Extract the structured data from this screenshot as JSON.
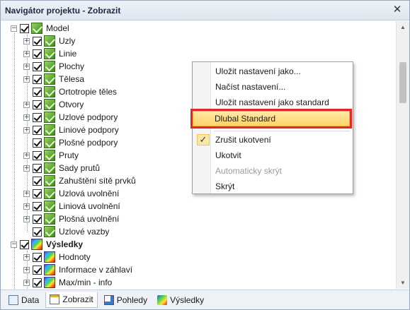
{
  "window": {
    "title": "Navigátor projektu - Zobrazit",
    "close_glyph": "✕"
  },
  "tree": {
    "root_model": "Model",
    "model_items": [
      "Uzly",
      "Linie",
      "Plochy",
      "Tělesa",
      "Ortotropie těles",
      "Otvory",
      "Uzlové podpory",
      "Liniové podpory",
      "Plošné podpory",
      "Pruty",
      "Sady prutů",
      "Zahuštění sítě prvků",
      "Uzlová uvolnění",
      "Liniová uvolnění",
      "Plošná uvolnění",
      "Uzlové vazby"
    ],
    "root_results": "Výsledky",
    "results_items": [
      "Hodnoty",
      "Informace v záhlaví",
      "Max/min - info"
    ]
  },
  "context_menu": {
    "save_as": "Uložit nastavení jako...",
    "load": "Načíst nastavení...",
    "save_default": "Uložit nastavení jako standard",
    "dlubal_standard": "Dlubal Standard",
    "unpin": "Zrušit ukotvení",
    "pin": "Ukotvit",
    "autohide": "Automaticky skrýt",
    "hide": "Skrýt",
    "check_glyph": "✓"
  },
  "tabs": {
    "data": "Data",
    "display": "Zobrazit",
    "views": "Pohledy",
    "results": "Výsledky"
  },
  "colors": {
    "highlight_border": "#e0282c",
    "highlight_fill": "#ffd269"
  }
}
